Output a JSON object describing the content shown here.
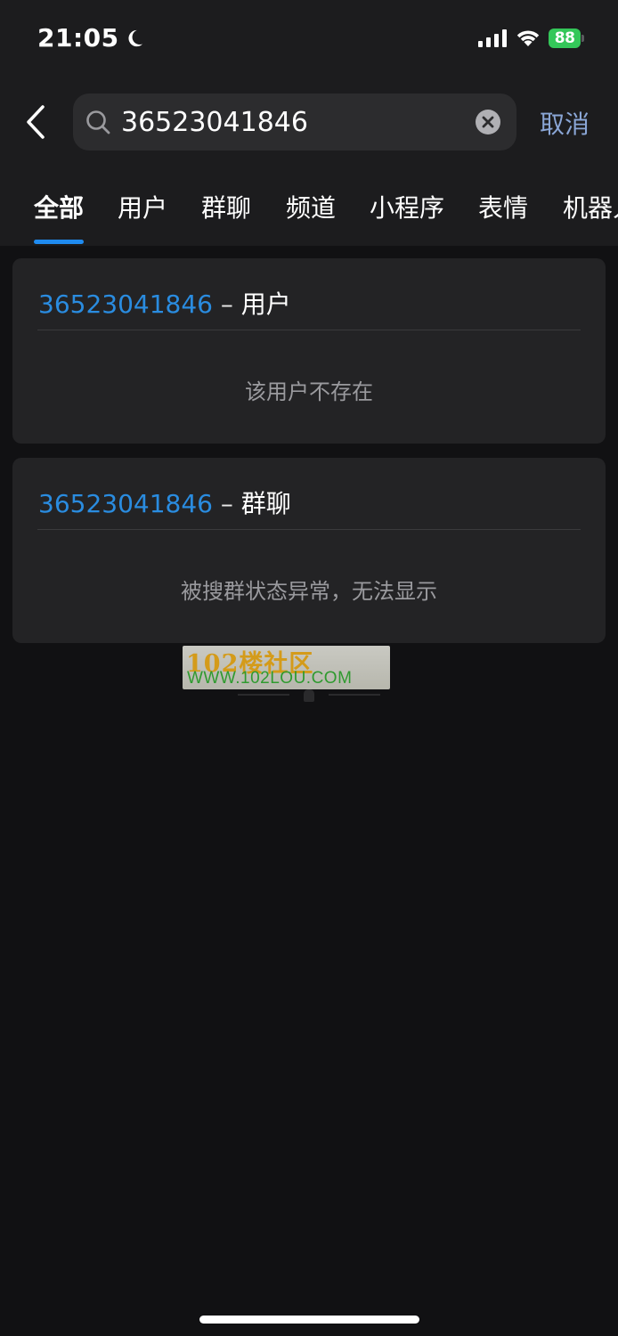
{
  "status_bar": {
    "time": "21:05",
    "battery": "88"
  },
  "search": {
    "query": "36523041846",
    "cancel_label": "取消"
  },
  "tabs": [
    {
      "label": "全部",
      "active": true
    },
    {
      "label": "用户"
    },
    {
      "label": "群聊"
    },
    {
      "label": "频道"
    },
    {
      "label": "小程序"
    },
    {
      "label": "表情"
    },
    {
      "label": "机器人"
    }
  ],
  "results": [
    {
      "query": "36523041846",
      "separator": "–",
      "kind": "用户",
      "message": "该用户不存在"
    },
    {
      "query": "36523041846",
      "separator": "–",
      "kind": "群聊",
      "message": "被搜群状态异常，无法显示"
    }
  ],
  "watermark": {
    "line1": "102楼社区",
    "line2": "WWW.102LOU.COM"
  },
  "colors": {
    "accent": "#1f8bf0",
    "link": "#2a8ce0",
    "cancel": "#8aa6d6",
    "battery": "#34c759"
  }
}
